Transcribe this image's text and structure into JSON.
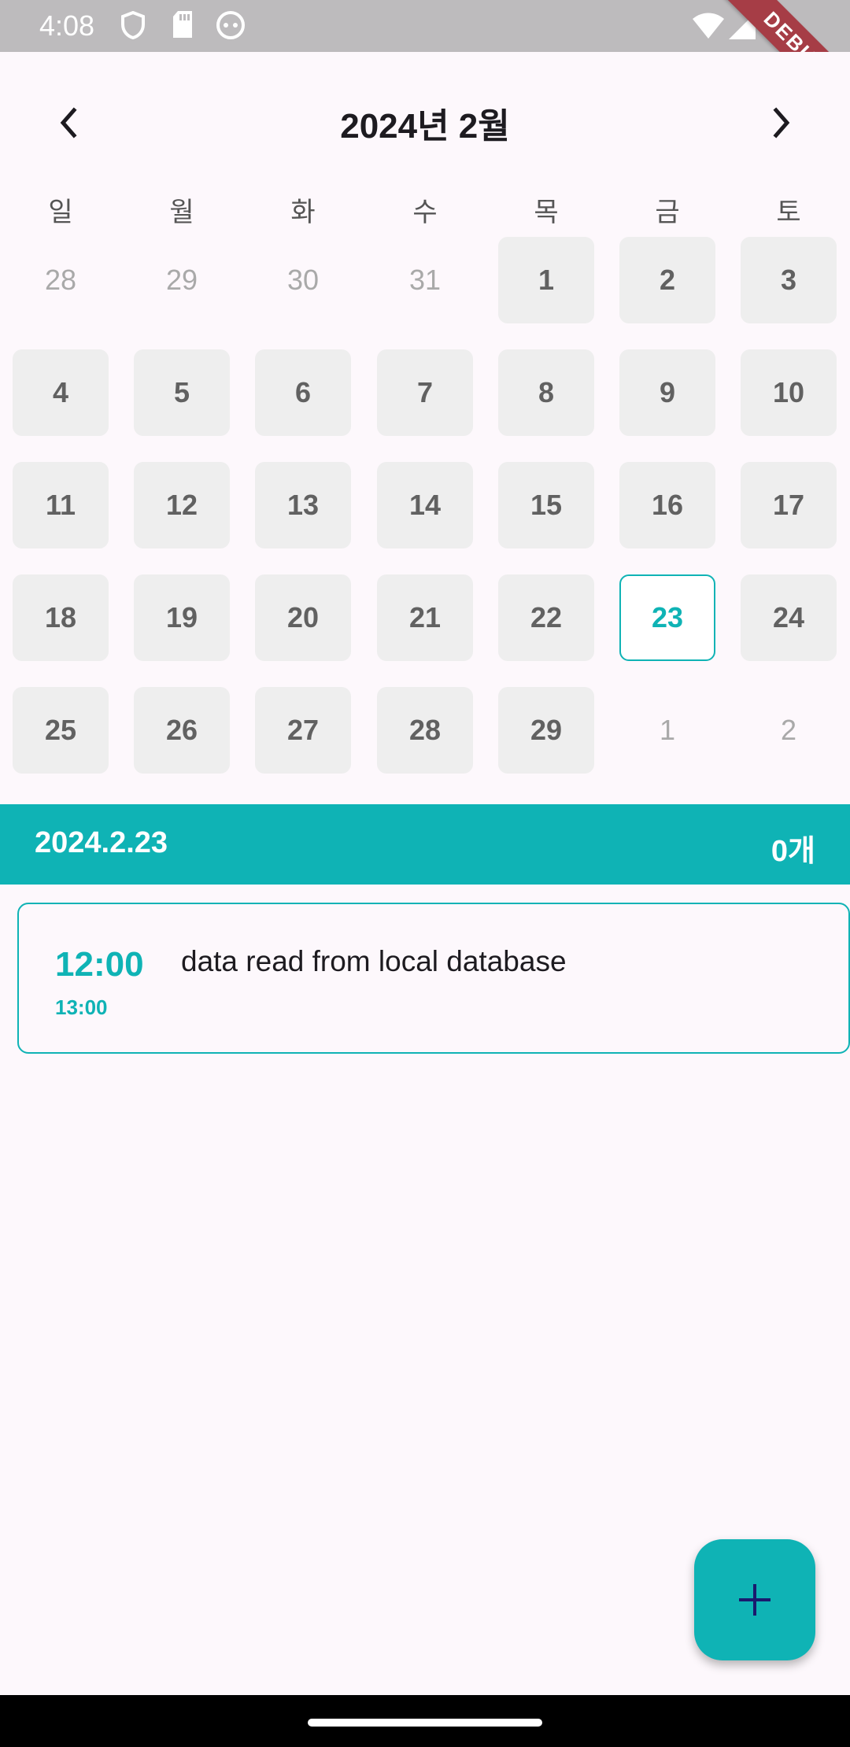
{
  "status_bar": {
    "time": "4:08",
    "debug_label": "DEBUG",
    "icons": [
      "shield-icon",
      "sd-card-icon",
      "android-debug-icon",
      "wifi-icon",
      "signal-icon",
      "battery-icon"
    ]
  },
  "calendar": {
    "month_title": "2024년 2월",
    "prev_icon": "chevron-left-icon",
    "next_icon": "chevron-right-icon",
    "weekdays": [
      "일",
      "월",
      "화",
      "수",
      "목",
      "금",
      "토"
    ],
    "weeks": [
      [
        {
          "d": "28",
          "m": false
        },
        {
          "d": "29",
          "m": false
        },
        {
          "d": "30",
          "m": false
        },
        {
          "d": "31",
          "m": false
        },
        {
          "d": "1",
          "m": true
        },
        {
          "d": "2",
          "m": true
        },
        {
          "d": "3",
          "m": true
        }
      ],
      [
        {
          "d": "4",
          "m": true
        },
        {
          "d": "5",
          "m": true
        },
        {
          "d": "6",
          "m": true
        },
        {
          "d": "7",
          "m": true
        },
        {
          "d": "8",
          "m": true
        },
        {
          "d": "9",
          "m": true
        },
        {
          "d": "10",
          "m": true
        }
      ],
      [
        {
          "d": "11",
          "m": true
        },
        {
          "d": "12",
          "m": true
        },
        {
          "d": "13",
          "m": true
        },
        {
          "d": "14",
          "m": true
        },
        {
          "d": "15",
          "m": true
        },
        {
          "d": "16",
          "m": true
        },
        {
          "d": "17",
          "m": true
        }
      ],
      [
        {
          "d": "18",
          "m": true
        },
        {
          "d": "19",
          "m": true
        },
        {
          "d": "20",
          "m": true
        },
        {
          "d": "21",
          "m": true
        },
        {
          "d": "22",
          "m": true
        },
        {
          "d": "23",
          "m": true,
          "selected": true
        },
        {
          "d": "24",
          "m": true
        }
      ],
      [
        {
          "d": "25",
          "m": true
        },
        {
          "d": "26",
          "m": true
        },
        {
          "d": "27",
          "m": true
        },
        {
          "d": "28",
          "m": true
        },
        {
          "d": "29",
          "m": true
        },
        {
          "d": "1",
          "m": false
        },
        {
          "d": "2",
          "m": false
        }
      ]
    ],
    "selected_day": "23"
  },
  "banner": {
    "date": "2024.2.23",
    "count": "0개"
  },
  "schedule": {
    "start_time": "12:00",
    "end_time": "13:00",
    "content": "data read from local database"
  },
  "fab": {
    "icon": "plus-icon"
  },
  "colors": {
    "accent": "#0fb3b5",
    "background": "#fdf8fc",
    "cell": "#eeeeee",
    "status_bar": "#bdbbbd",
    "debug_ribbon": "#a63d46",
    "fab_icon": "#1a1a6e"
  }
}
